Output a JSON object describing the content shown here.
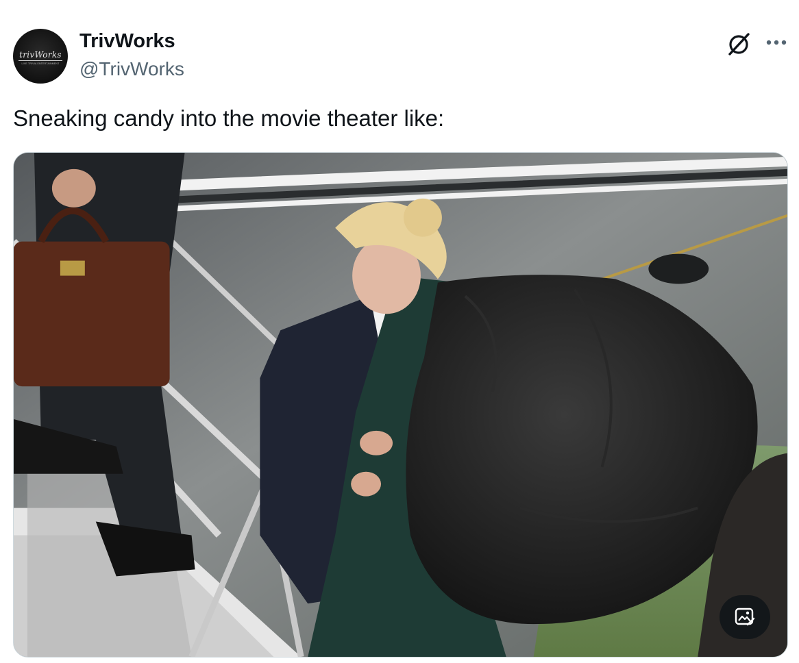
{
  "author": {
    "name": "TrivWorks",
    "handle": "@TrivWorks",
    "avatar_logo_text": "trivWorks",
    "avatar_tagline": "LIVE TRIVIA ENTERTAINMENT"
  },
  "tweet": {
    "text": "Sneaking candy into the movie theater like:"
  },
  "icons": {
    "grok": "grok-icon",
    "more": "more-icon",
    "image_alt": "image-alt-icon"
  }
}
